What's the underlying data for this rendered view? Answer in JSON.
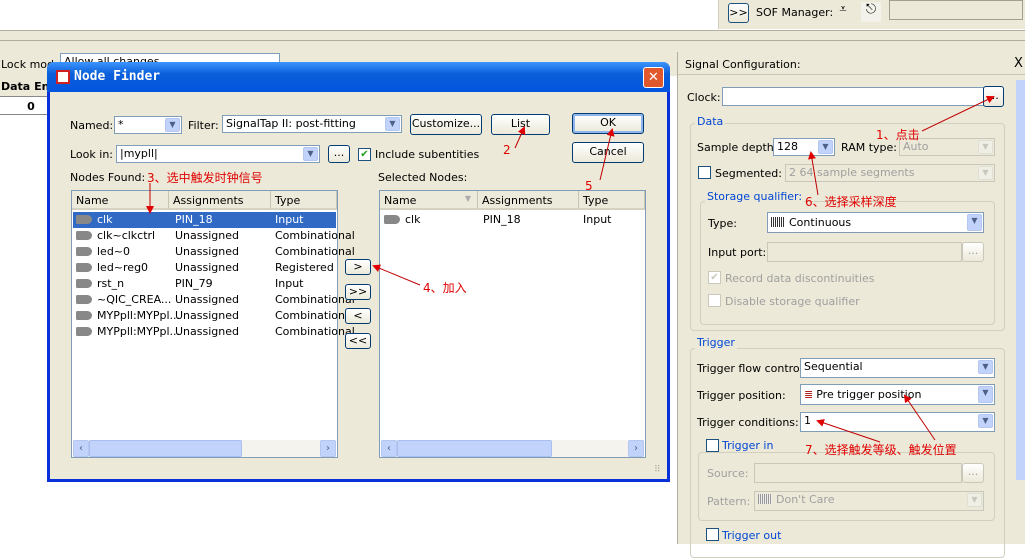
{
  "toolbar": {
    "expand_label": ">>",
    "sof_manager_label": "SOF Manager:",
    "program_icon": "program-device-icon",
    "attach_icon": "paperclip-icon"
  },
  "background": {
    "lock_mode_label": "Lock mode",
    "lock_mode_value": "Allow all changes",
    "column_header": "Data Enable",
    "cell_value": "0"
  },
  "dialog": {
    "title": "Node Finder",
    "named_label": "Named:",
    "named_value": "*",
    "filter_label": "Filter:",
    "filter_value": "SignalTap II: post-fitting",
    "customize_label": "Customize...",
    "list_label": "List",
    "ok_label": "OK",
    "cancel_label": "Cancel",
    "look_in_label": "Look in:",
    "look_in_value": "|mypll|",
    "browse_label": "...",
    "include_subentities_label": "Include subentities",
    "include_subentities_checked": true,
    "nodes_found_label": "Nodes Found:",
    "selected_nodes_label": "Selected Nodes:",
    "columns": [
      "Name",
      "Assignments",
      "Type"
    ],
    "nodes_found": [
      {
        "name": "clk",
        "assignment": "PIN_18",
        "type": "Input",
        "selected": true
      },
      {
        "name": "clk~clkctrl",
        "assignment": "Unassigned",
        "type": "Combinational"
      },
      {
        "name": "led~0",
        "assignment": "Unassigned",
        "type": "Combinational"
      },
      {
        "name": "led~reg0",
        "assignment": "Unassigned",
        "type": "Registered"
      },
      {
        "name": "rst_n",
        "assignment": "PIN_79",
        "type": "Input"
      },
      {
        "name": "~QIC_CREA...",
        "assignment": "Unassigned",
        "type": "Combinational"
      },
      {
        "name": "MYPpll:MYPpl...",
        "assignment": "Unassigned",
        "type": "Combinational"
      },
      {
        "name": "MYPpll:MYPpl...",
        "assignment": "Unassigned",
        "type": "Combinational"
      }
    ],
    "selected_nodes": [
      {
        "name": "clk",
        "assignment": "PIN_18",
        "type": "Input"
      }
    ],
    "move_buttons": [
      ">",
      ">>",
      "<",
      "<<"
    ]
  },
  "signal_config": {
    "title": "Signal Configuration:",
    "close_label": "X",
    "clock_label": "Clock:",
    "clock_value": "",
    "clock_browse": "...",
    "data_group": "Data",
    "sample_depth_label": "Sample depth:",
    "sample_depth_value": "128",
    "ram_type_label": "RAM type:",
    "ram_type_value": "Auto",
    "segmented_label": "Segmented:",
    "segmented_value": "2  64 sample segments",
    "storage_group": "Storage qualifier:",
    "type_label": "Type:",
    "type_value": "Continuous",
    "input_port_label": "Input port:",
    "input_port_browse": "...",
    "record_label": "Record data discontinuities",
    "disable_label": "Disable storage qualifier",
    "trigger_group": "Trigger",
    "flow_label": "Trigger flow control:",
    "flow_value": "Sequential",
    "position_label": "Trigger position:",
    "position_value": "Pre trigger position",
    "conditions_label": "Trigger conditions:",
    "conditions_value": "1",
    "trigger_in_label": "Trigger in",
    "source_label": "Source:",
    "source_browse": "...",
    "pattern_label": "Pattern:",
    "pattern_value": "Don't Care",
    "trigger_out_label": "Trigger out"
  },
  "annotations": {
    "a1": "1、点击",
    "a2": "2",
    "a3": "3、选中触发时钟信号",
    "a4": "4、加入",
    "a5": "5",
    "a6": "6、选择采样深度",
    "a7": "7、选择触发等级、触发位置",
    "color": "#e00000"
  },
  "colors": {
    "titlebar": "#0a5fd8",
    "selection": "#316ac5",
    "window_bg": "#ece9d8"
  }
}
